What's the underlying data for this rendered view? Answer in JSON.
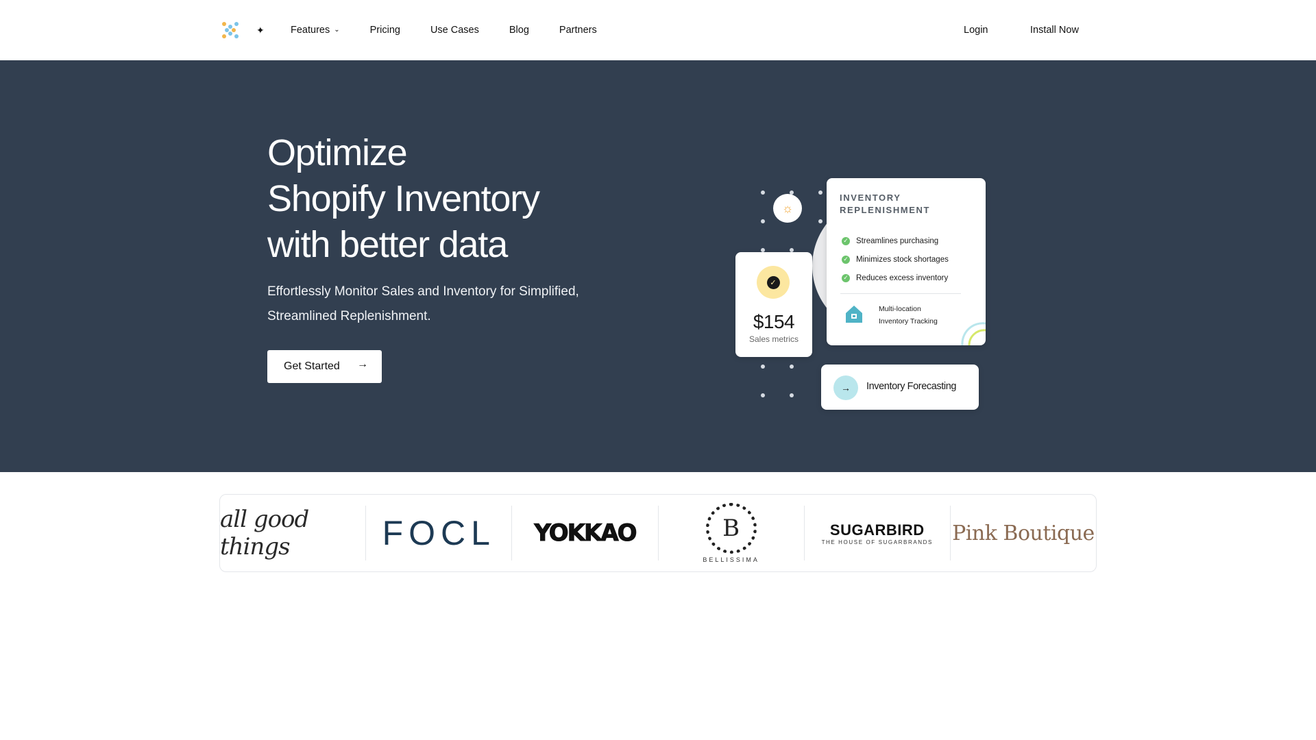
{
  "nav": {
    "logo_icon": "dots-logo-icon",
    "sparkle": "✦",
    "items": [
      {
        "label": "Features",
        "has_dropdown": true
      },
      {
        "label": "Pricing"
      },
      {
        "label": "Use Cases"
      },
      {
        "label": "Blog"
      },
      {
        "label": "Partners"
      }
    ],
    "login": "Login",
    "install": "Install Now"
  },
  "hero": {
    "title_lines": [
      "Optimize",
      "Shopify Inventory",
      "with better data"
    ],
    "subtitle_lines": [
      "Effortlessly Monitor Sales and Inventory for Simplified,",
      "Streamlined Replenishment."
    ],
    "cta": "Get Started",
    "cta_arrow": "→",
    "background": "#323f50"
  },
  "illustration": {
    "replenishment": {
      "title": "INVENTORY REPLENISHMENT",
      "bullets": [
        "Streamlines purchasing",
        "Minimizes stock shortages",
        "Reduces excess inventory"
      ],
      "feature_line1": "Multi-location",
      "feature_line2": "Inventory Tracking"
    },
    "sales": {
      "amount": "$154",
      "label": "Sales metrics"
    },
    "forecast": {
      "label": "Inventory Forecasting",
      "arrow": "→"
    }
  },
  "brands": [
    {
      "name": "all good things",
      "style": "script"
    },
    {
      "name": "FOCL",
      "style": "sans"
    },
    {
      "name": "YOKKAO",
      "style": "bold"
    },
    {
      "name": "BELLISSIMA",
      "style": "crest",
      "monogram": "B"
    },
    {
      "name": "SUGARBIRD",
      "tagline": "THE HOUSE OF SUGARBRANDS",
      "style": "bold"
    },
    {
      "name": "Pink Boutique",
      "style": "serif"
    }
  ],
  "colors": {
    "hero_bg": "#323f50",
    "check_green": "#6cc46c",
    "focl_blue": "#1d3a54",
    "pink_brown": "#8a6a52"
  }
}
